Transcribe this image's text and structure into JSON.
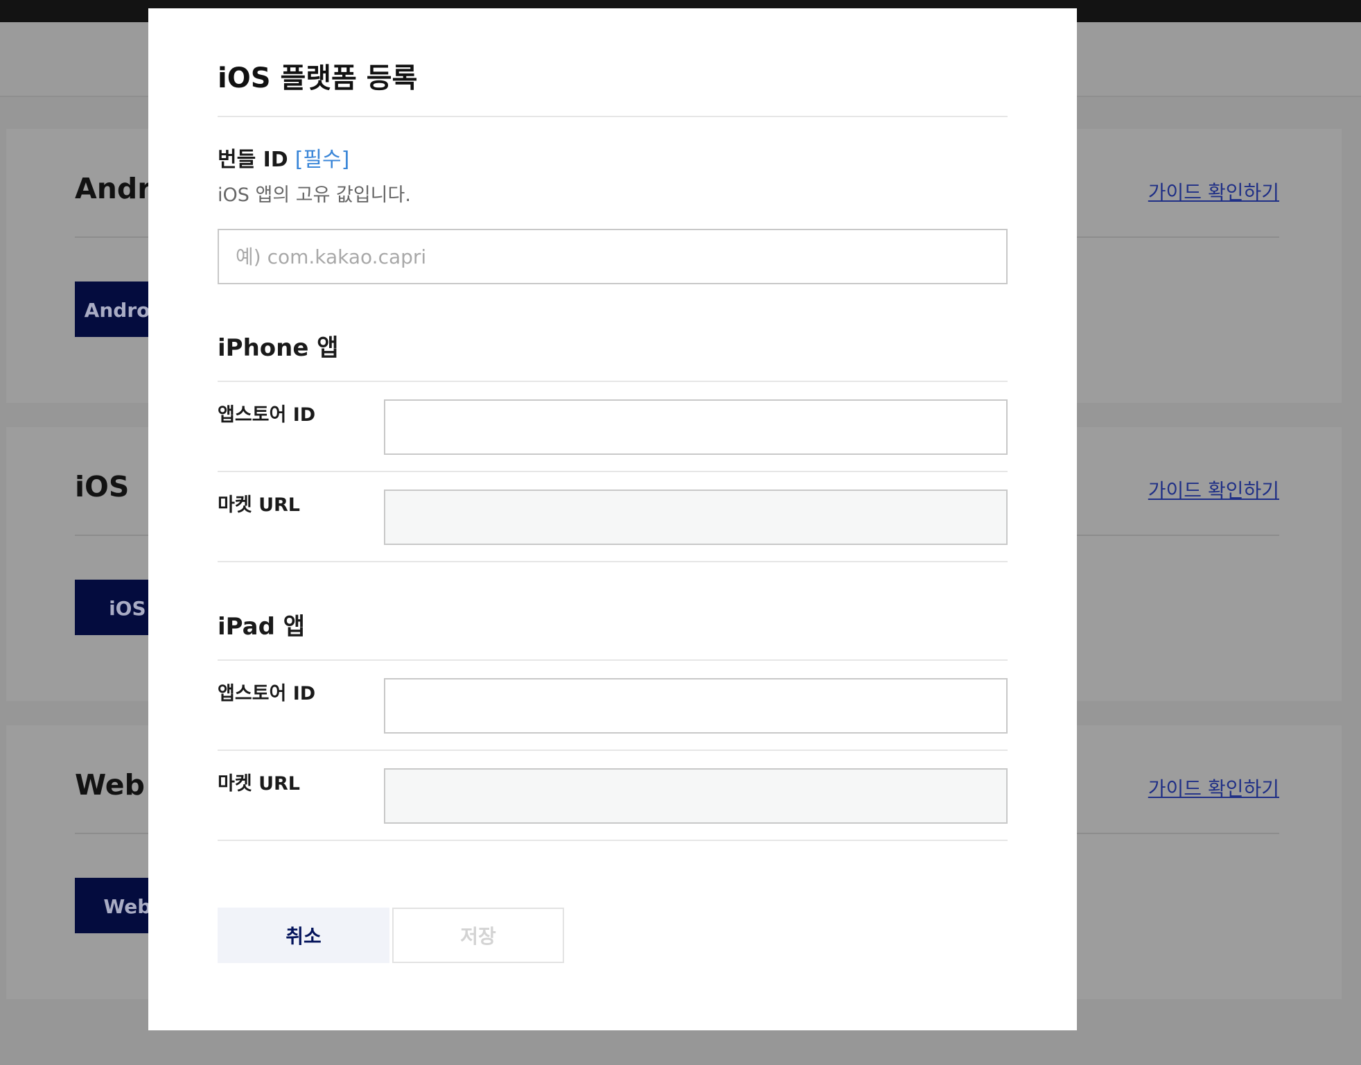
{
  "background": {
    "cards": [
      {
        "title": "Android",
        "guide_link": "가이드 확인하기",
        "button": "Android 플랫폼 등록"
      },
      {
        "title": "iOS",
        "guide_link": "가이드 확인하기",
        "button": "iOS 플랫폼 등록"
      },
      {
        "title": "Web",
        "guide_link": "가이드 확인하기",
        "button": "Web 플랫폼 등록"
      }
    ]
  },
  "modal": {
    "title": "iOS 플랫폼 등록",
    "bundle": {
      "label": "번들 ID",
      "required": "[필수]",
      "description": "iOS 앱의 고유 값입니다.",
      "placeholder": "예) com.kakao.capri",
      "value": ""
    },
    "iphone": {
      "section_title": "iPhone 앱",
      "appstore_label": "앱스토어 ID",
      "market_label": "마켓 URL",
      "appstore_value": "",
      "market_value": ""
    },
    "ipad": {
      "section_title": "iPad 앱",
      "appstore_label": "앱스토어 ID",
      "market_label": "마켓 URL",
      "appstore_value": "",
      "market_value": ""
    },
    "buttons": {
      "cancel": "취소",
      "save": "저장"
    }
  }
}
